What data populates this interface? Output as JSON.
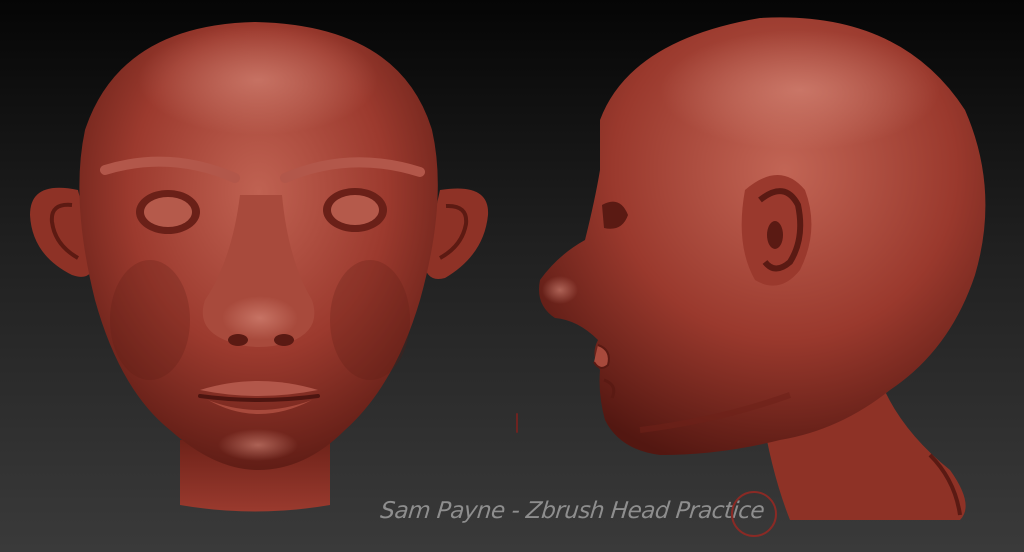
{
  "caption": {
    "text": "Sam Payne - Zbrush Head Practice"
  },
  "colors": {
    "background_top": "#050505",
    "background_bottom": "#3a3a3a",
    "clay_base": "#9c3a2e",
    "clay_highlight": "#c86a5a",
    "clay_shadow": "#4e1510",
    "caption_text": "#8e8e8e",
    "brush_cursor": "#8a2a25"
  },
  "models": [
    {
      "name": "front-view-head",
      "view": "front"
    },
    {
      "name": "side-view-head",
      "view": "profile-left"
    }
  ],
  "tools": {
    "brush_cursor_icon": "circle-brush-cursor-icon"
  }
}
